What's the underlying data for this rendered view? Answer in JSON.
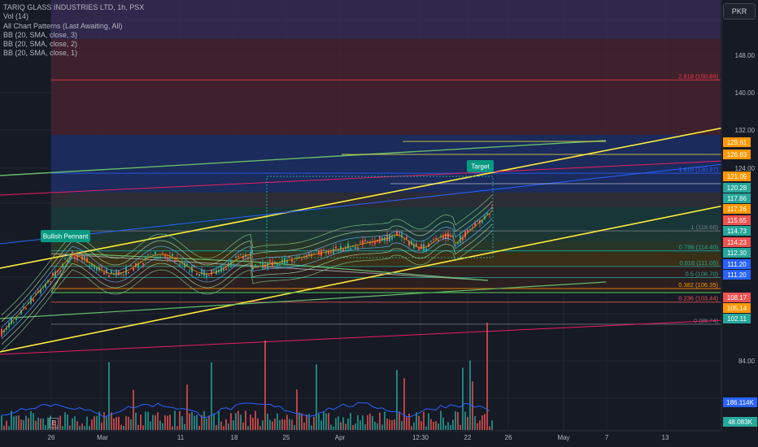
{
  "header": {
    "symbol_line": "TARIQ GLASS INDUSTRIES LTD, 1h, PSX",
    "indicators": [
      "Vol (14)",
      "All Chart Patterns (Last Awaiting, All)",
      "BB (20, SMA, close, 3)",
      "BB (20, SMA, close, 2)",
      "BB (20, SMA, close, 1)"
    ],
    "currency": "PKR",
    "e_marker": "E"
  },
  "colors": {
    "background": "#161a25",
    "up": "#26a69a",
    "down": "#ef5350",
    "yellow": "#ffeb3b",
    "green_line": "#4caf50",
    "blue_line": "#2962ff",
    "red_line": "#f23645",
    "orange": "#ff9800"
  },
  "chart_data": {
    "type": "line",
    "x_tick_labels": [
      "26",
      "Mar",
      "11",
      "18",
      "25",
      "Apr",
      "12:30",
      "22",
      "26",
      "May",
      "7",
      "13"
    ],
    "price_axis": {
      "ylim": [
        81,
        154
      ],
      "ticks": [
        "148.00",
        "140.00",
        "132.00",
        "124.00",
        "84.00"
      ]
    },
    "price_tags": [
      {
        "value": "129.61",
        "color": "#ff9800"
      },
      {
        "value": "126.83",
        "color": "#ff9800"
      },
      {
        "value": "121.09",
        "color": "#ff9800"
      },
      {
        "value": "120.28",
        "color": "#26a69a"
      },
      {
        "value": "117.86",
        "color": "#26a69a"
      },
      {
        "value": "117.26",
        "color": "#ff9800"
      },
      {
        "value": "115.65",
        "color": "#ef5350"
      },
      {
        "value": "114.73",
        "color": "#26a69a"
      },
      {
        "value": "114.23",
        "color": "#ef5350"
      },
      {
        "value": "112.30",
        "color": "#26a69a"
      },
      {
        "value": "111.20",
        "color": "#2962ff"
      },
      {
        "value": "111.20",
        "color": "#2962ff"
      },
      {
        "value": "108.17",
        "color": "#ef5350"
      },
      {
        "value": "105.14",
        "color": "#ff9800"
      },
      {
        "value": "102.11",
        "color": "#26a69a"
      }
    ],
    "volume_tags": [
      {
        "value": "186.114K",
        "color": "#2962ff"
      },
      {
        "value": "48.083K",
        "color": "#26a69a"
      }
    ],
    "fib_levels": [
      {
        "label": "2.618 (150.89)",
        "price": 150.89,
        "color": "#f23645"
      },
      {
        "label": "1.618 (130.97)",
        "price": 130.97,
        "color": "#2962ff"
      },
      {
        "label": "1 (118.66)",
        "price": 118.66,
        "color": "#787b86"
      },
      {
        "label": "0.786 (114.40)",
        "price": 114.4,
        "color": "#26a69a"
      },
      {
        "label": "0.618 (111.05)",
        "price": 111.05,
        "color": "#26a69a"
      },
      {
        "label": "0.5 (108.70)",
        "price": 108.7,
        "color": "#26a69a"
      },
      {
        "label": "0.382 (106.35)",
        "price": 106.35,
        "color": "#ff9800"
      },
      {
        "label": "0.236 (103.44)",
        "price": 103.44,
        "color": "#ef5350"
      },
      {
        "label": "0 (98.74)",
        "price": 98.74,
        "color": "#787b86"
      }
    ],
    "annotations": [
      "Bullish Pennant",
      "Target"
    ],
    "grid": true
  }
}
